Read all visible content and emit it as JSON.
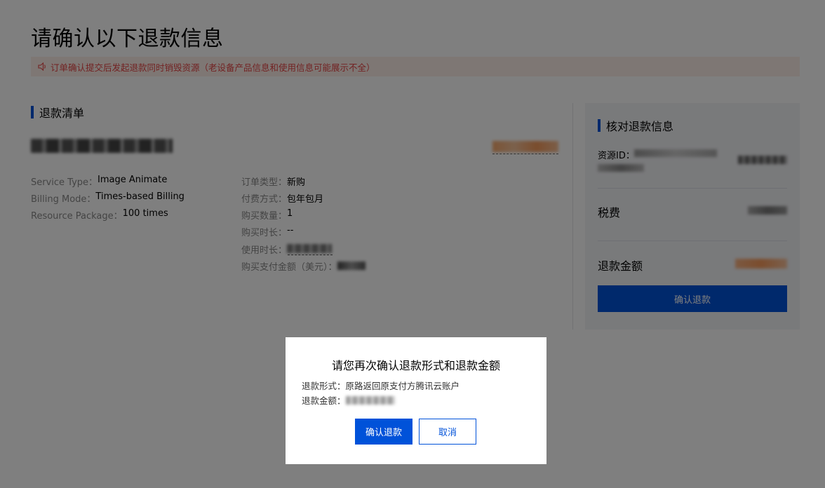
{
  "page": {
    "title": "请确认以下退款信息",
    "notice": "订单确认提交后发起退款同时销毁资源（老设备产品信息和使用信息可能展示不全）"
  },
  "refund_list": {
    "section_title": "退款清单",
    "left_fields": [
      {
        "key": "Service Type：",
        "value": "Image Animate"
      },
      {
        "key": "Billing Mode：",
        "value": "Times-based Billing"
      },
      {
        "key": "Resource Package：",
        "value": "100 times"
      }
    ],
    "right_fields": [
      {
        "key": "订单类型：",
        "value": "新购"
      },
      {
        "key": "付费方式：",
        "value": "包年包月"
      },
      {
        "key": "购买数量：",
        "value": "1"
      },
      {
        "key": "购买时长：",
        "value": "--"
      },
      {
        "key": "使用时长：",
        "value": ""
      },
      {
        "key": "购买支付金额（美元）：",
        "value": ""
      }
    ]
  },
  "verify_panel": {
    "section_title": "核对退款信息",
    "resource_id_label": "资源ID：",
    "tax_label": "税费",
    "refund_amount_label": "退款金额",
    "confirm_button": "确认退款"
  },
  "modal": {
    "title": "请您再次确认退款形式和退款金额",
    "refund_method_label": "退款形式：",
    "refund_method_value": "原路返回原支付方腾讯云账户",
    "refund_amount_label": "退款金额：",
    "confirm_button": "确认退款",
    "cancel_button": "取消"
  },
  "colors": {
    "accent": "#0052d9",
    "warning_text": "#e54545",
    "price": "#ff7200"
  }
}
